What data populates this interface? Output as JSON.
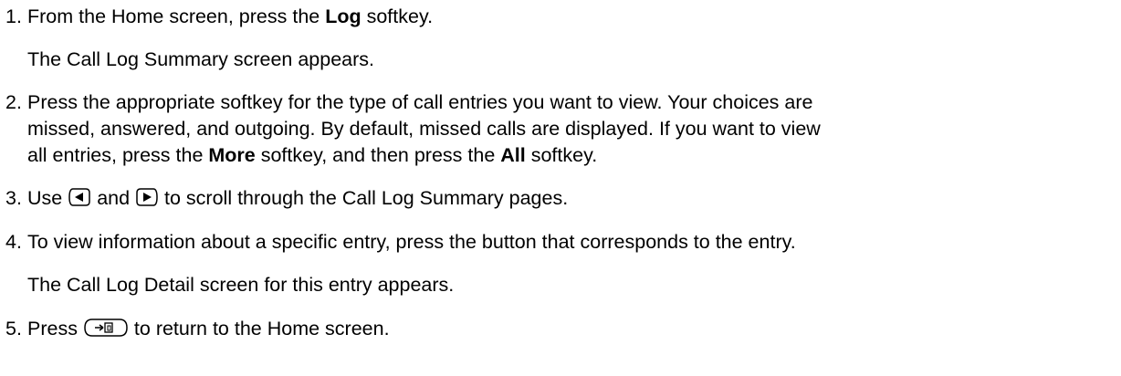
{
  "steps": [
    {
      "number": "1.",
      "parts": [
        "From the Home screen, press the ",
        "Log",
        " softkey."
      ],
      "result": "The Call Log Summary screen appears."
    },
    {
      "number": "2.",
      "lines": [
        "Press the appropriate softkey for the type of call entries you want to view. Your choices are",
        "missed, answered, and outgoing. By default, missed calls are displayed. If you want to view"
      ],
      "last_parts": [
        "all entries, press the ",
        "More",
        " softkey, and then press the ",
        "All",
        " softkey."
      ]
    },
    {
      "number": "3.",
      "parts": [
        "Use ",
        " and ",
        " to scroll through the Call Log Summary pages."
      ],
      "icons": [
        "left-arrow-key-icon",
        "right-arrow-key-icon"
      ]
    },
    {
      "number": "4.",
      "text": "To view information about a specific entry, press the button that corresponds to the entry.",
      "result": "The Call Log Detail screen for this entry appears."
    },
    {
      "number": "5.",
      "parts": [
        "Press ",
        " to return to the Home screen."
      ],
      "icons": [
        "home-exit-key-icon"
      ]
    }
  ]
}
